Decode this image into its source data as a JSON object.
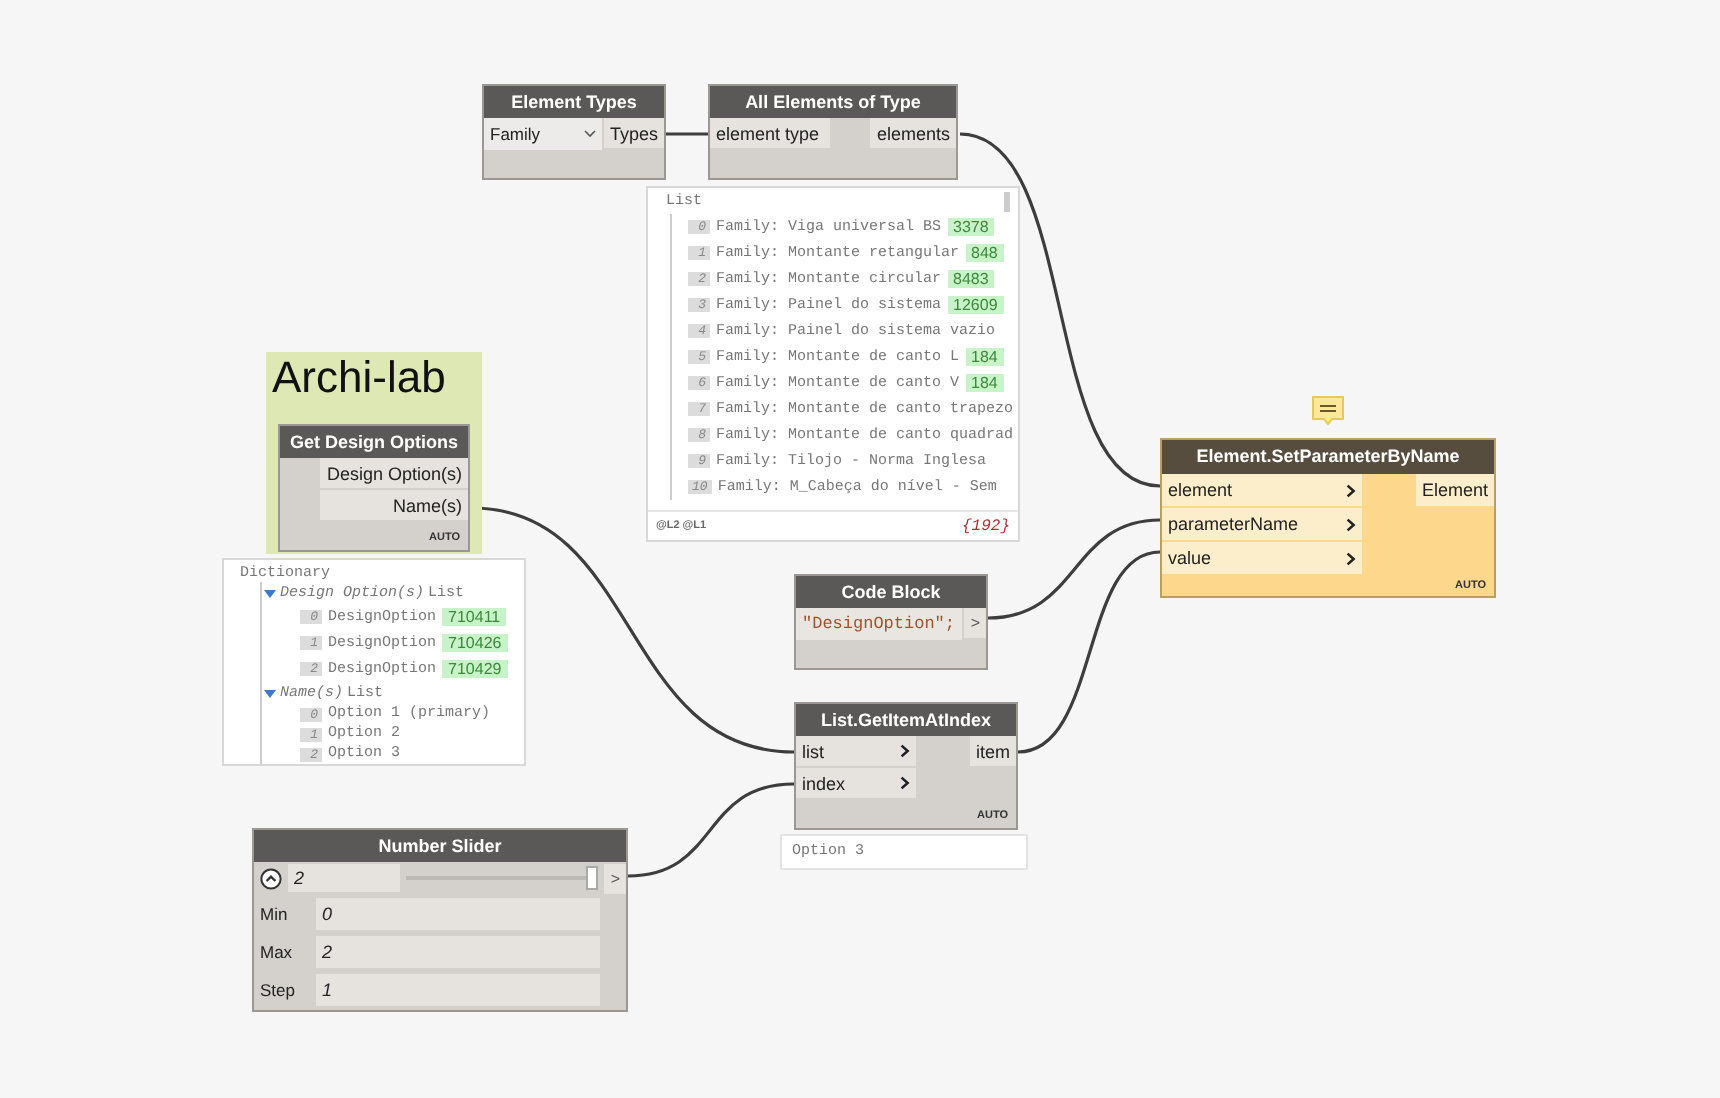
{
  "group": {
    "title": "Archi-lab"
  },
  "nodes": [
    {
      "kind": "dropdown",
      "title": "Element Types",
      "value": "Family",
      "outputs": [
        "Types"
      ]
    },
    {
      "kind": "function",
      "title": "All Elements of Type",
      "inputs": [
        "element type"
      ],
      "outputs": [
        "elements"
      ],
      "level_toggles": false,
      "preview": {
        "kind": "list",
        "title": "List",
        "items": [
          {
            "index": "0",
            "text": "Family: Viga universal BS",
            "badge": "3378"
          },
          {
            "index": "1",
            "text": "Family: Montante retangular",
            "badge": "848"
          },
          {
            "index": "2",
            "text": "Family: Montante circular",
            "badge": "8483"
          },
          {
            "index": "3",
            "text": "Family: Painel do sistema",
            "badge": "12609"
          },
          {
            "index": "4",
            "text": "Family: Painel do sistema vazio"
          },
          {
            "index": "5",
            "text": "Family: Montante de canto L",
            "badge": "184"
          },
          {
            "index": "6",
            "text": "Family: Montante de canto V",
            "badge": "184"
          },
          {
            "index": "7",
            "text": "Family: Montante de canto trapezo"
          },
          {
            "index": "8",
            "text": "Family: Montante de canto quadrad"
          },
          {
            "index": "9",
            "text": "Family: Tilojo - Norma Inglesa"
          },
          {
            "index": "10",
            "text": "Family: M_Cabeça do nível - Sem"
          }
        ],
        "levels": "@L2 @L1",
        "count": "{192}"
      }
    },
    {
      "kind": "function",
      "title": "Get Design Options",
      "outputs": [
        "Design Option(s)",
        "Name(s)"
      ],
      "lacing": "AUTO",
      "preview": {
        "kind": "dictionary",
        "title": "Dictionary",
        "entries": [
          {
            "key": "Design Option(s)",
            "type": "List",
            "expanded": true,
            "items": [
              {
                "index": "0",
                "text": "DesignOption",
                "badge": "710411"
              },
              {
                "index": "1",
                "text": "DesignOption",
                "badge": "710426"
              },
              {
                "index": "2",
                "text": "DesignOption",
                "badge": "710429"
              }
            ]
          },
          {
            "key": "Name(s)",
            "type": "List",
            "expanded": true,
            "items": [
              {
                "index": "0",
                "text": "Option 1 (primary)"
              },
              {
                "index": "1",
                "text": "Option 2"
              },
              {
                "index": "2",
                "text": "Option 3"
              }
            ]
          }
        ]
      }
    },
    {
      "kind": "function",
      "title": "Element.SetParameterByName",
      "warning": true,
      "inputs": [
        "element",
        "parameterName",
        "value"
      ],
      "outputs": [
        "Element"
      ],
      "lacing": "AUTO",
      "level_toggles": true
    },
    {
      "kind": "code",
      "title": "Code Block",
      "code": "\"DesignOption\";",
      "outputs": [
        ">"
      ]
    },
    {
      "kind": "function",
      "title": "List.GetItemAtIndex",
      "inputs": [
        "list",
        "index"
      ],
      "outputs": [
        "item"
      ],
      "lacing": "AUTO",
      "level_toggles": true,
      "preview": {
        "kind": "value",
        "text": "Option 3"
      }
    },
    {
      "kind": "slider",
      "title": "Number Slider",
      "value": "2",
      "level": 1,
      "outputs": [
        ">"
      ],
      "expanded": true,
      "fields": [
        {
          "label": "Min",
          "value": "0"
        },
        {
          "label": "Max",
          "value": "2"
        },
        {
          "label": "Step",
          "value": "1"
        }
      ]
    }
  ]
}
